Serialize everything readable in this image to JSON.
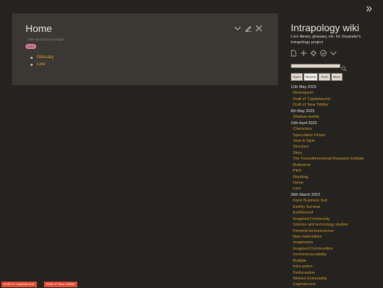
{
  "story": {
    "title": "Home",
    "subtitle": "15th April 2023 at 8:48pm",
    "tag": "Intro",
    "links": [
      "Glossary",
      "Lore"
    ]
  },
  "sidebar": {
    "title": "Intrapology wiki",
    "subtitle": "Lore library, glossary, etc. for Zoyander's Intrapology project",
    "search": {
      "value": ""
    },
    "tabs": [
      {
        "label": "Open"
      },
      {
        "label": "Recent",
        "active": true
      },
      {
        "label": "Tools"
      },
      {
        "label": "More"
      }
    ],
    "recent": [
      {
        "kind": "date",
        "text": "11th May 2023"
      },
      {
        "kind": "link",
        "text": "Neuroqueer"
      },
      {
        "kind": "link",
        "text": "Draft of 'Capitalocene'"
      },
      {
        "kind": "link",
        "text": "Draft of 'New Tiddler'"
      },
      {
        "kind": "date",
        "text": "6th May 2023"
      },
      {
        "kind": "link",
        "text": "Shadow worlds"
      },
      {
        "kind": "date",
        "text": "19th April 2023"
      },
      {
        "kind": "link",
        "text": "Characters"
      },
      {
        "kind": "link",
        "text": "Speculative Fiction"
      },
      {
        "kind": "link",
        "text": "Tone & Style"
      },
      {
        "kind": "link",
        "text": "Structure"
      },
      {
        "kind": "link",
        "text": "Story"
      },
      {
        "kind": "link",
        "text": "The Transdimensional Research Institute"
      },
      {
        "kind": "link",
        "text": "Multiverse"
      },
      {
        "kind": "link",
        "text": "Pitch"
      },
      {
        "kind": "link",
        "text": "Worlding"
      },
      {
        "kind": "link",
        "text": "Home"
      },
      {
        "kind": "link",
        "text": "Lore"
      },
      {
        "kind": "date",
        "text": "26th March 2023"
      },
      {
        "kind": "link",
        "text": "Ironic Business Suit"
      },
      {
        "kind": "link",
        "text": "Earthly Survival"
      },
      {
        "kind": "link",
        "text": "Earthbound"
      },
      {
        "kind": "link",
        "text": "Imagined Community"
      },
      {
        "kind": "link",
        "text": "Science and technology studies"
      },
      {
        "kind": "link",
        "text": "Feminist technoscience"
      },
      {
        "kind": "link",
        "text": "New materialism"
      },
      {
        "kind": "link",
        "text": "Imaginaries"
      },
      {
        "kind": "link",
        "text": "Imagined Communities"
      },
      {
        "kind": "link",
        "text": "Incommensurability"
      },
      {
        "kind": "link",
        "text": "Multiple"
      },
      {
        "kind": "link",
        "text": "Intra-action"
      },
      {
        "kind": "link",
        "text": "Performative"
      },
      {
        "kind": "link",
        "text": "Wicked Universality"
      },
      {
        "kind": "link",
        "text": "Capitalocene"
      }
    ]
  },
  "notifications": [
    {
      "label": "Draft of 'Capitalocene'"
    },
    {
      "label": "Draft of 'New Tiddler'"
    }
  ],
  "colors": {
    "background": "#252320",
    "tiddler": "#3b3834",
    "link": "#cd9c2c",
    "tag": "#d87d9b",
    "notification": "#e24a30"
  },
  "icons": {
    "tiddler_controls": [
      "chevron-down-icon",
      "edit-icon",
      "close-icon"
    ],
    "page_controls": [
      "new-tiddler-icon",
      "plus-icon",
      "settings-icon",
      "check-circle-icon",
      "chevron-down-icon"
    ],
    "sidebar_toggle": "double-chevron-right-icon",
    "search": "search-icon"
  }
}
